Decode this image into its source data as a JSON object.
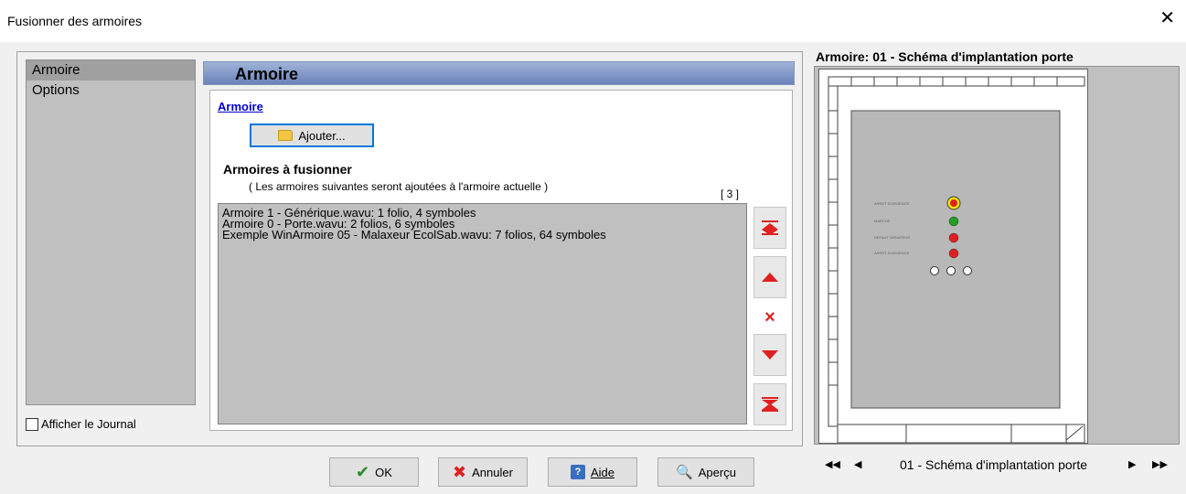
{
  "window": {
    "title": "Fusionner des armoires",
    "close_icon": "close-icon"
  },
  "nav": {
    "items": [
      {
        "label": "Armoire",
        "selected": true
      },
      {
        "label": "Options",
        "selected": false
      }
    ]
  },
  "journal": {
    "label": "Afficher le Journal",
    "checked": false
  },
  "section": {
    "header": "Armoire",
    "link": "Armoire",
    "add_button": "Ajouter...",
    "merge_title": "Armoires à fusionner",
    "merge_subtitle": "( Les armoires suivantes seront ajoutées à l'armoire actuelle )",
    "count": "[ 3 ]",
    "items": [
      "Armoire 1 - Générique.wavu: 1 folio, 4 symboles",
      "Armoire 0 - Porte.wavu: 2 folios, 6 symboles",
      "Exemple WinArmoire 05 - Malaxeur EcolSab.wavu: 7 folios, 64 symboles"
    ]
  },
  "preview": {
    "title": "Armoire: 01 - Schéma d'implantation porte",
    "page_label": "01 - Schéma d'implantation porte",
    "colors": {
      "panel": "#b8b8b8",
      "indicator_yellow": "#f2e200",
      "indicator_red": "#e02020",
      "indicator_green": "#20a020"
    }
  },
  "buttons": {
    "ok": "OK",
    "cancel": "Annuler",
    "help": "Aide",
    "preview": "Aperçu"
  },
  "colors": {
    "accent_red": "#e02020",
    "focus_blue": "#0078d7",
    "list_bg": "#c0c0c0"
  }
}
